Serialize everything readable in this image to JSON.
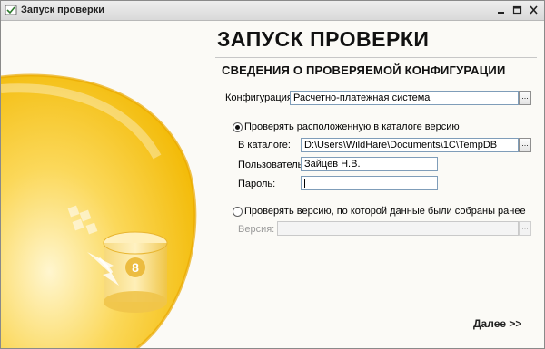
{
  "window": {
    "title": "Запуск проверки"
  },
  "heading": "ЗАПУСК ПРОВЕРКИ",
  "subheading": "СВЕДЕНИЯ О ПРОВЕРЯЕМОЙ КОНФИГУРАЦИИ",
  "config": {
    "label": "Конфигурация:",
    "value": "Расчетно-платежная система"
  },
  "option_catalog": {
    "label": "Проверять расположенную в каталоге версию",
    "selected": true,
    "catalog_label": "В каталоге:",
    "catalog_value": "D:\\Users\\WildHare\\Documents\\1C\\TempDB",
    "user_label": "Пользователь:",
    "user_value": "Зайцев Н.В.",
    "password_label": "Пароль:",
    "password_value": ""
  },
  "option_version": {
    "label": "Проверять версию, по которой данные были собраны ранее",
    "selected": false,
    "version_label": "Версия:",
    "version_value": ""
  },
  "browse_label": "...",
  "next_label": "Далее >>",
  "art_digit": "8",
  "colors": {
    "accent_yellow": "#f5c518",
    "panel_bg": "#fbfaf6",
    "field_border": "#7f9db9"
  }
}
